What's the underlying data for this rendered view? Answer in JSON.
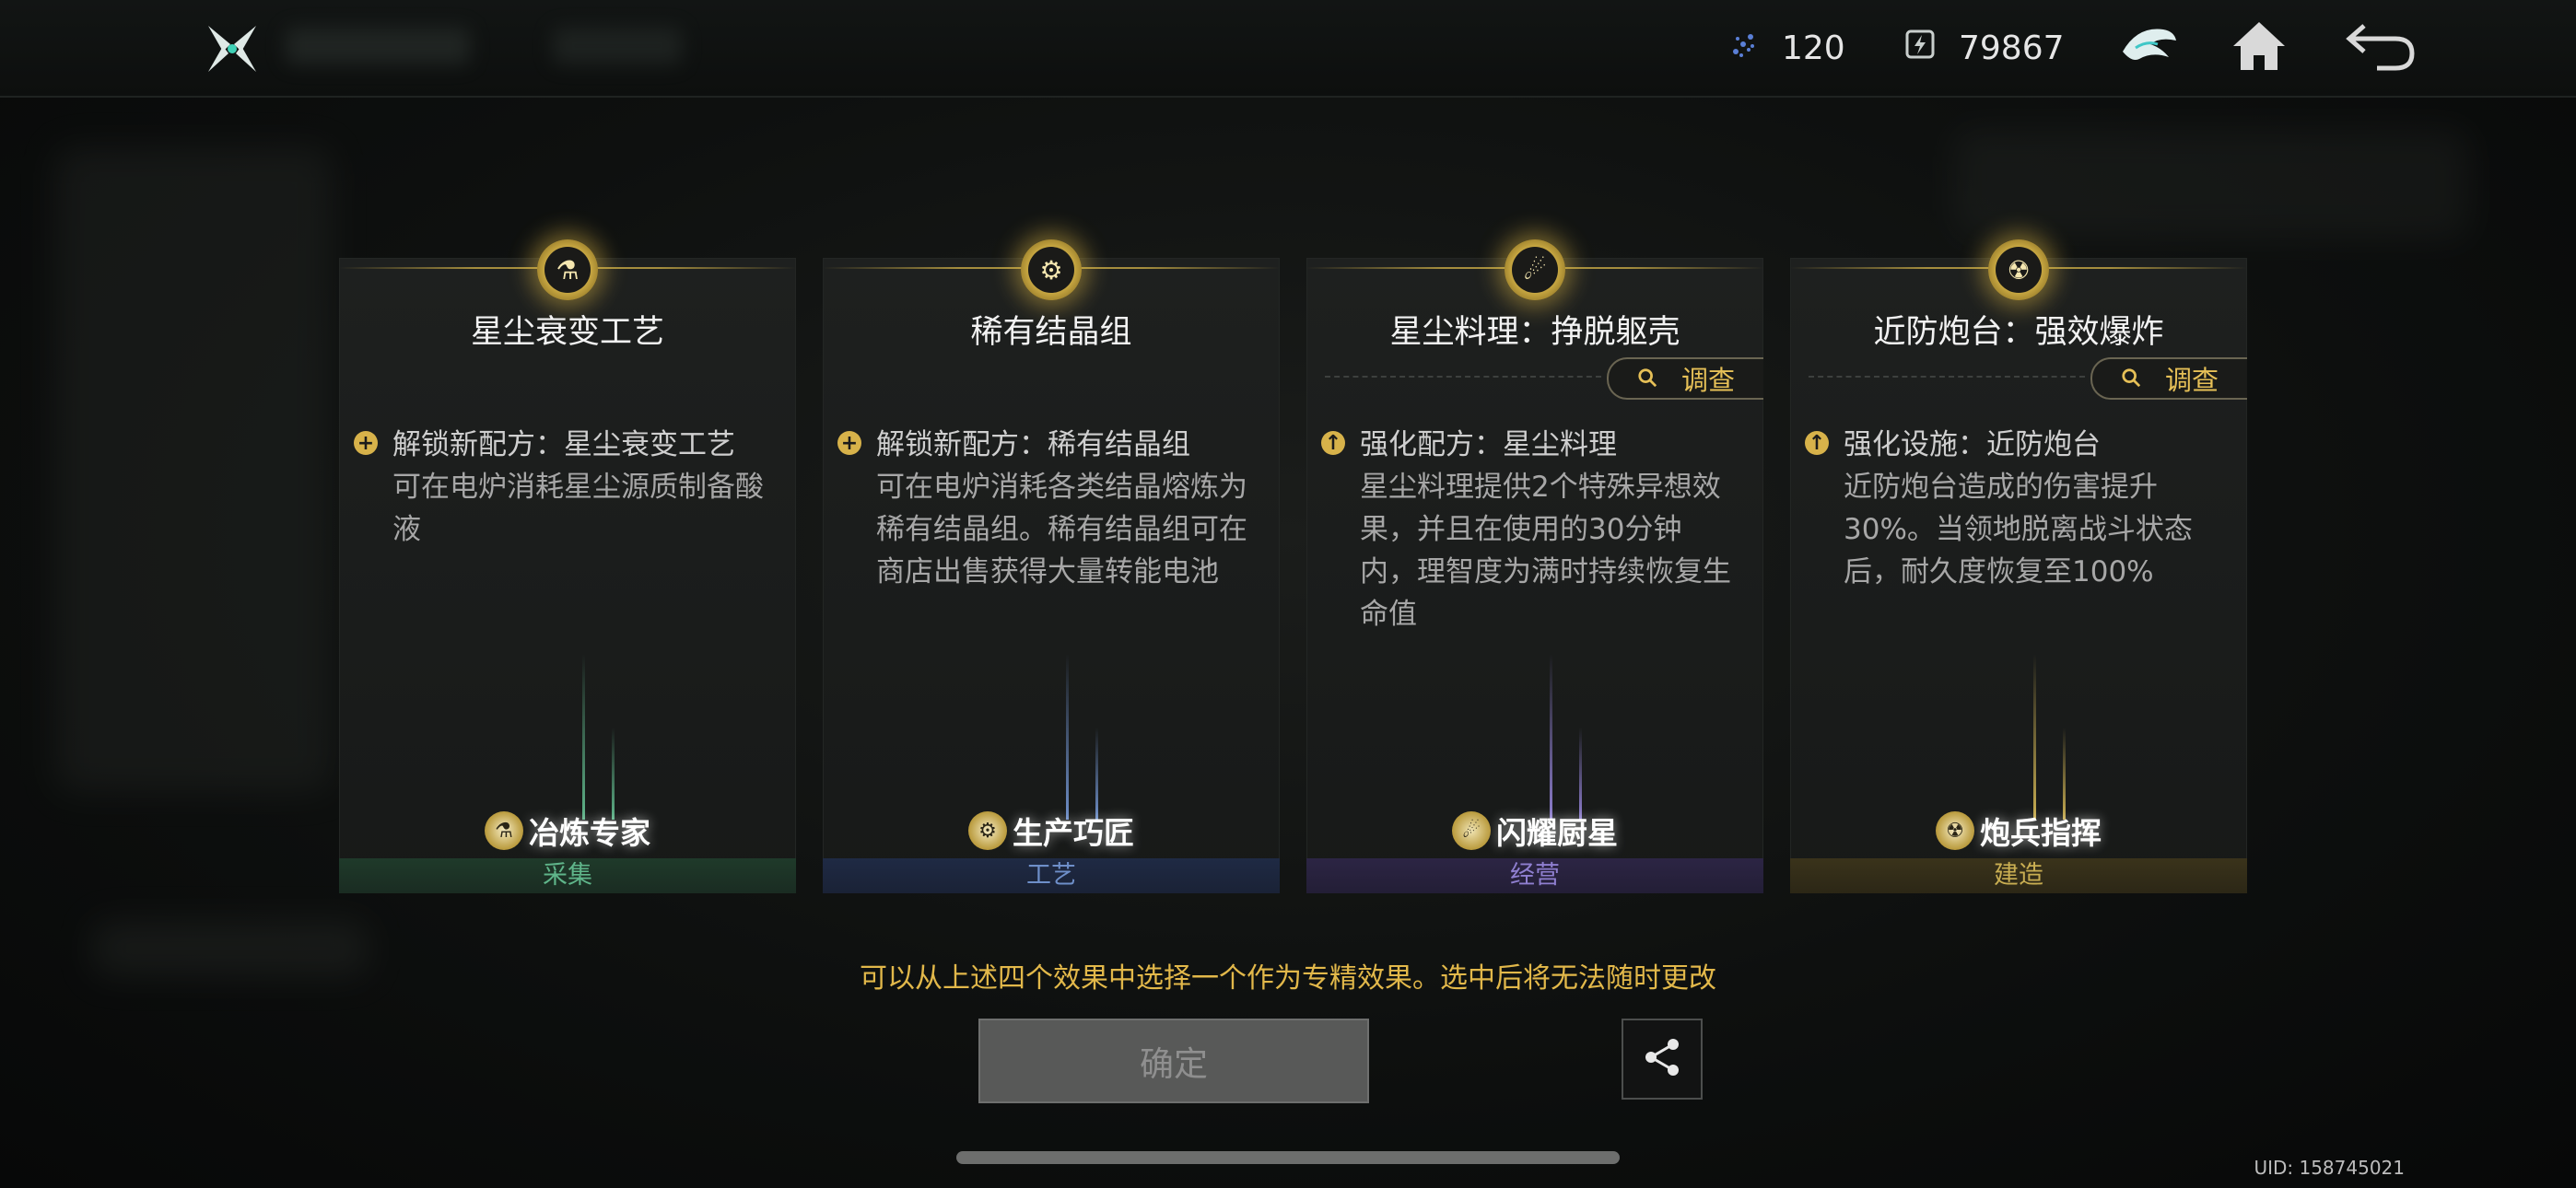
{
  "topbar": {
    "resources": [
      {
        "icon": "crystal-icon",
        "value": "120"
      },
      {
        "icon": "energy-cell-icon",
        "value": "79867"
      }
    ],
    "buttons": [
      "crest-icon",
      "home-icon",
      "back-icon"
    ]
  },
  "cards": [
    {
      "title": "星尘衰变工艺",
      "has_inspect": false,
      "effect_head": "解锁新配方：星尘衰变工艺",
      "effect_body": "可在电炉消耗星尘源质制备酸液",
      "profession": "冶炼专家",
      "category": "采集",
      "accent": "#5fb58a"
    },
    {
      "title": "稀有结晶组",
      "has_inspect": false,
      "effect_head": "解锁新配方：稀有结晶组",
      "effect_body": "可在电炉消耗各类结晶熔炼为稀有结晶组。稀有结晶组可在商店出售获得大量转能电池",
      "profession": "生产巧匠",
      "category": "工艺",
      "accent": "#6e8fc9"
    },
    {
      "title": "星尘料理：挣脱躯壳",
      "has_inspect": true,
      "inspect_label": "调查",
      "effect_head": "强化配方：星尘料理",
      "effect_body": "星尘料理提供2个特殊异想效果，并且在使用的30分钟内，理智度为满时持续恢复生命值",
      "profession": "闪耀厨星",
      "category": "经营",
      "accent": "#8f7fd0"
    },
    {
      "title": "近防炮台：强效爆炸",
      "has_inspect": true,
      "inspect_label": "调查",
      "effect_head": "强化设施：近防炮台",
      "effect_body": "近防炮台造成的伤害提升30%。当领地脱离战斗状态后，耐久度恢复至100%",
      "profession": "炮兵指挥",
      "category": "建造",
      "accent": "#c9ae52"
    }
  ],
  "hint": "可以从上述四个效果中选择一个作为专精效果。选中后将无法随时更改",
  "confirm_label": "确定",
  "uid": "UID: 158745021",
  "colors": {
    "gold": "#e2b84a",
    "background": "#0e100f"
  }
}
